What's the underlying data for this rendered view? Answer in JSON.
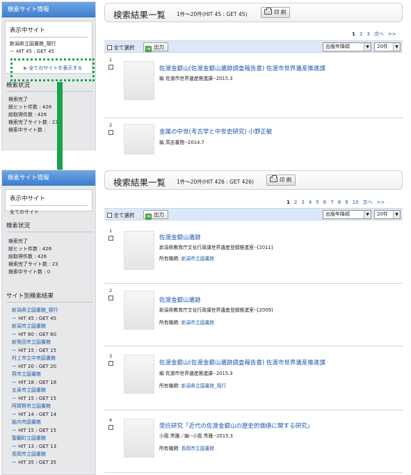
{
  "panel1": {
    "sidebar": {
      "header": "検索サイト情報",
      "display_title": "表示中サイト",
      "display_site": "新潟県立図書館_現行",
      "display_counts": "－ HIT 45 : GET 45",
      "show_all_link": "全てのサイトを表示する",
      "status_title": "検索状況",
      "stats": [
        "検索完了",
        "総ヒット件数 : 426",
        "総取得件数 : 426",
        "検索完了サイト数 : 23",
        "検索中サイト数 :"
      ]
    },
    "header": {
      "title": "検索結果一覧",
      "range": "1件～20件(HIT 45 : GET 45)",
      "print": "印 刷"
    },
    "pager": [
      "1",
      "2",
      "3",
      "次へ",
      ">>"
    ],
    "toolbar": {
      "select_all": "全て選択",
      "export": "出力",
      "sort": "出版年降順",
      "per_page": "20件"
    },
    "records": [
      {
        "num": "1",
        "title": "佐渡金銀山(佐渡金銀山遺跡調査報告書)  佐渡市世界遺産推進課",
        "meta": "編  佐渡市世界遺産推進課--2015.3"
      },
      {
        "num": "2",
        "title": "金属の中世(考古学と中世史研究)  小野正敏",
        "meta": "編  高志書院--2014.7"
      }
    ]
  },
  "panel2": {
    "sidebar": {
      "header": "検索サイト情報",
      "display_title": "表示中サイト",
      "display_site": "全てのサイト",
      "status_title": "検索状況",
      "stats": [
        "検索完了",
        "総ヒット件数 : 426",
        "総取得件数 : 426",
        "検索完了サイト数 : 23",
        "検索中サイト数 : 0"
      ],
      "by_site_title": "サイト別検索結果",
      "sites": [
        {
          "name": "新潟県立図書館_現行",
          "counts": "－ HIT 45 : GET 45"
        },
        {
          "name": "新潟市立図書館",
          "counts": "－ HIT 60 : GET 60"
        },
        {
          "name": "新発田市立図書館",
          "counts": "－ HIT 15 : GET 15"
        },
        {
          "name": "村上市立中央図書館",
          "counts": "－ HIT 20 : GET 20"
        },
        {
          "name": "燕市立図書館",
          "counts": "－ HIT 18 : GET 18"
        },
        {
          "name": "五泉市立図書館",
          "counts": "－ HIT 15 : GET 15"
        },
        {
          "name": "阿賀野市立図書館",
          "counts": "－ HIT 14 : GET 14"
        },
        {
          "name": "胎内市図書館",
          "counts": "－ HIT 15 : GET 15"
        },
        {
          "name": "聖籠町立図書館",
          "counts": "－ HIT 13 : GET 13"
        },
        {
          "name": "長岡市立図書館",
          "counts": "－ HIT 35 : GET 35"
        }
      ]
    },
    "header": {
      "title": "検索結果一覧",
      "range": "1件～20件(HIT 426 : GET 426)",
      "print": "印 刷"
    },
    "pager": [
      "1",
      "2",
      "3",
      "4",
      "5",
      "6",
      "7",
      "8",
      "9",
      "10",
      "次へ",
      ">>"
    ],
    "toolbar": {
      "select_all": "全て選択",
      "export": "出力",
      "sort": "出版年降順",
      "per_page": "20件"
    },
    "holding_label": "所有機関:",
    "records": [
      {
        "num": "1",
        "title": "佐渡金銀山遺跡",
        "meta": "新潟県教育庁文化行政課世界遺産登録推進室--[2011]",
        "holder": "新潟市立図書館"
      },
      {
        "num": "2",
        "title": "佐渡金銀山遺跡",
        "meta": "新潟県教育庁文化行政課世界遺産登録推進室--[2009]",
        "holder": "新潟市立図書館"
      },
      {
        "num": "3",
        "title": "佐渡金銀山(佐渡金銀山遺跡調査報告書)  佐渡市世界遺産推進課",
        "meta": "編  佐渡市世界遺産推進課--2015.3",
        "holder": "新潟県立図書館_現行"
      },
      {
        "num": "4",
        "title": "受託研究「近代の佐渡金銀山の歴史的価値に関する研究」",
        "meta": "小風  秀雅／編--小風  秀雅--2015.3",
        "holder": "長岡市立図書館"
      }
    ]
  }
}
